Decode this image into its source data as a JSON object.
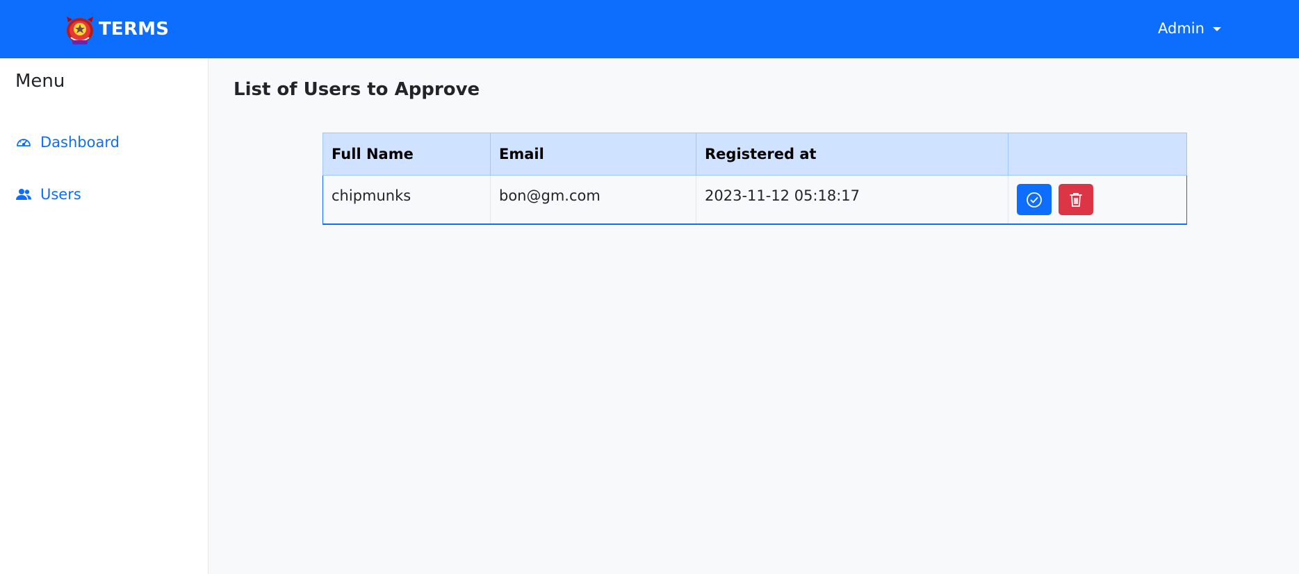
{
  "navbar": {
    "brand": "TERMS",
    "user_menu": "Admin",
    "colors": {
      "background": "#0d6efd",
      "text": "#ffffff"
    }
  },
  "sidebar": {
    "title": "Menu",
    "items": [
      {
        "label": "Dashboard",
        "icon": "speedometer-icon"
      },
      {
        "label": "Users",
        "icon": "users-icon"
      }
    ]
  },
  "main": {
    "title": "List of Users to Approve",
    "table": {
      "headers": [
        "Full Name",
        "Email",
        "Registered at",
        ""
      ],
      "rows": [
        {
          "full_name": "chipmunks",
          "email": "bon@gm.com",
          "registered_at": "2023-11-12 05:18:17",
          "actions": [
            {
              "icon": "check-circle-icon",
              "color": "#0d6efd"
            },
            {
              "icon": "trash-icon",
              "color": "#dc3545"
            }
          ]
        }
      ]
    }
  }
}
